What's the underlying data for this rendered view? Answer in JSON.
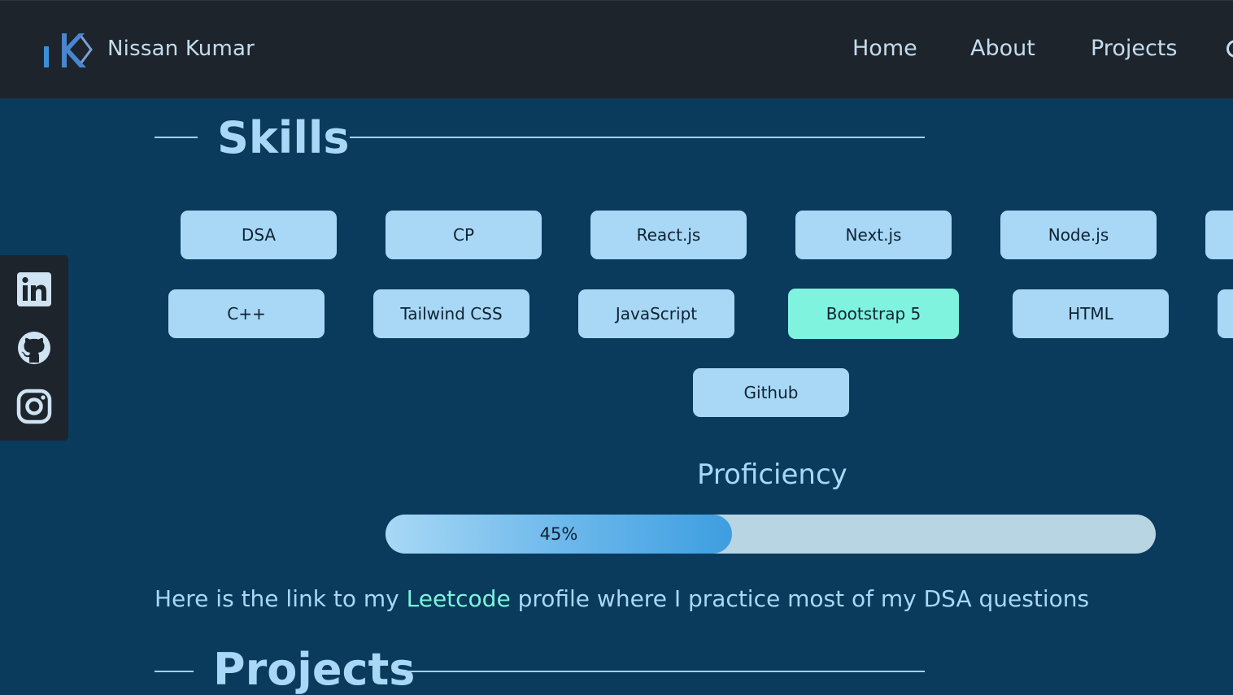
{
  "navbar": {
    "brand": "Nissan Kumar",
    "links": [
      "Home",
      "About",
      "Projects"
    ]
  },
  "skills": {
    "title": "Skills",
    "row1": [
      "DSA",
      "CP",
      "React.js",
      "Next.js",
      "Node.js"
    ],
    "row2": [
      "C++",
      "Tailwind CSS",
      "JavaScript",
      "Bootstrap 5",
      "HTML"
    ],
    "row3": [
      "Github"
    ]
  },
  "proficiency": {
    "title": "Proficiency",
    "value": 45,
    "label": "45%"
  },
  "leetcode": {
    "before": "Here is the link to my ",
    "link": "Leetcode",
    "after": " profile where I practice most of my DSA questions"
  },
  "projects": {
    "title": "Projects"
  },
  "social": [
    "linkedin-icon",
    "github-icon",
    "instagram-icon"
  ],
  "colors": {
    "navbar_bg": "#1d242b",
    "page_bg": "#0a3a5c",
    "pill": "#a8d8f5",
    "pill_active": "#7ff3dd",
    "accent_link": "#7ff3dd"
  }
}
